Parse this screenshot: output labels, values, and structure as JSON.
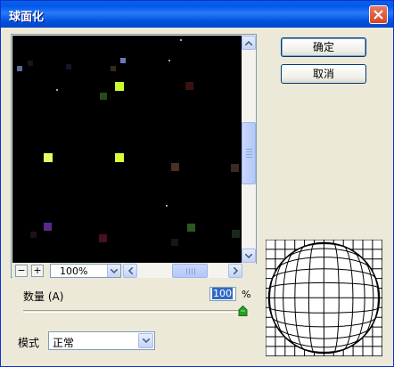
{
  "window": {
    "title": "球面化"
  },
  "buttons": {
    "ok": "确定",
    "cancel": "取消"
  },
  "preview": {
    "zoom": "100%",
    "zoom_in": "+",
    "zoom_out": "−"
  },
  "amount": {
    "label": "数量 (A)",
    "value": "100",
    "unit": "%",
    "level_percent": 100
  },
  "mode": {
    "label": "模式",
    "value": "正常"
  },
  "colors": {
    "title_bar": "#0058ee",
    "dialog_bg": "#ece9d8",
    "preview_bg": "#000000",
    "accent_selection": "#316ac5"
  },
  "icons": {
    "close": "close-icon",
    "scroll_up": "arrow-up-icon",
    "scroll_down": "arrow-down-icon",
    "scroll_left": "arrow-left-icon",
    "scroll_right": "arrow-right-icon",
    "dropdown": "chevron-down-icon",
    "slider": "slider-thumb-icon",
    "sphere": "sphere-grid-icon"
  }
}
